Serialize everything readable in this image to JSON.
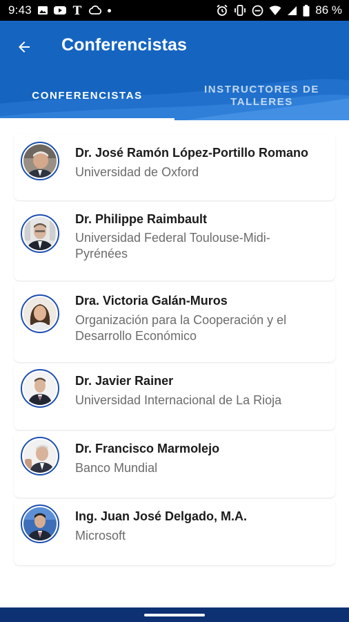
{
  "status_bar": {
    "time": "9:43",
    "battery": "86 %",
    "left_icons": [
      "image-icon",
      "youtube-icon",
      "nyt-icon",
      "cloud-icon",
      "dot-icon"
    ],
    "right_icons": [
      "alarm-icon",
      "vibrate-icon",
      "dnd-icon",
      "wifi-icon",
      "signal-icon",
      "battery-icon"
    ]
  },
  "app_bar": {
    "title": "Conferencistas",
    "background_color": "#1565c0"
  },
  "tabs": [
    {
      "label": "CONFERENCISTAS",
      "active": true
    },
    {
      "label": "INSTRUCTORES DE TALLERES",
      "active": false
    }
  ],
  "speakers": [
    {
      "name": "Dr. José Ramón López-Portillo Romano",
      "org": "Universidad de Oxford"
    },
    {
      "name": "Dr. Philippe Raimbault",
      "org": "Universidad Federal Toulouse-Midi-Pyrénées"
    },
    {
      "name": "Dra. Victoria Galán-Muros",
      "org": "Organización para la Cooperación y el Desarrollo Económico"
    },
    {
      "name": "Dr. Javier Rainer",
      "org": "Universidad Internacional de La Rioja"
    },
    {
      "name": "Dr. Francisco Marmolejo",
      "org": "Banco Mundial"
    },
    {
      "name": "Ing. Juan José Delgado, M.A.",
      "org": "Microsoft"
    }
  ]
}
